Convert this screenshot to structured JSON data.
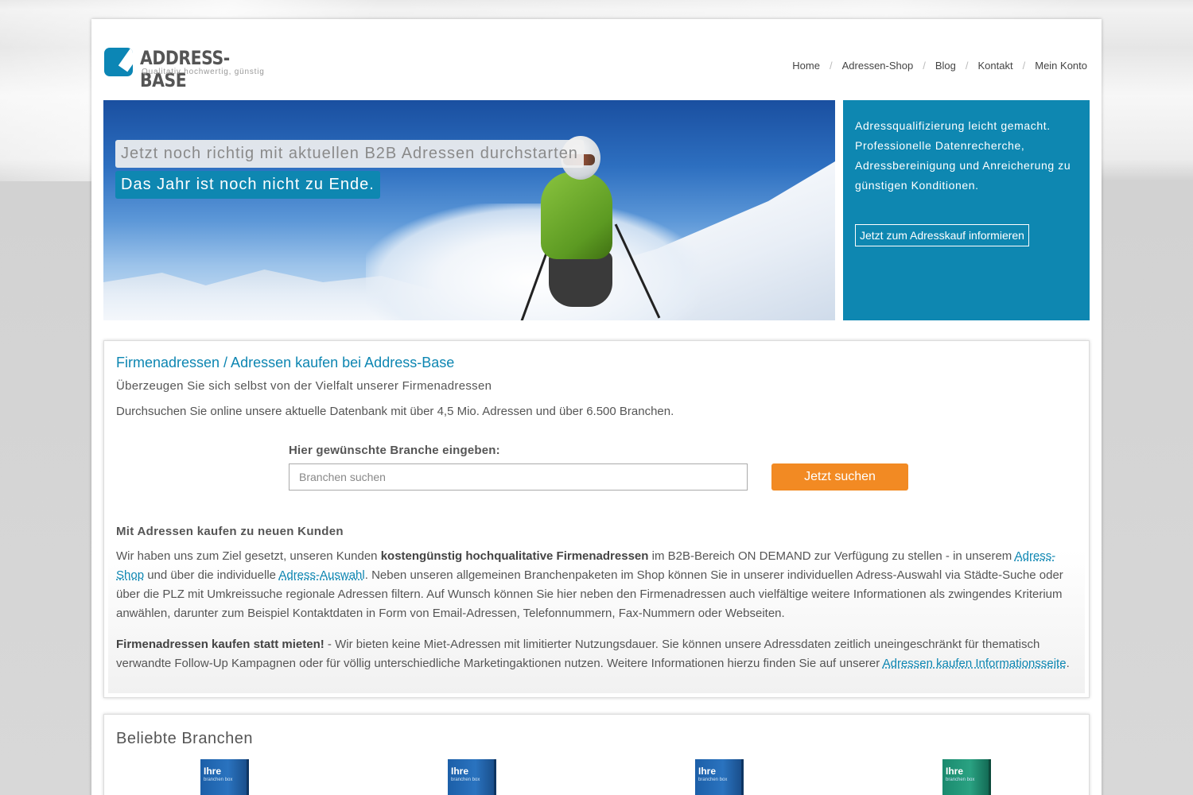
{
  "brand": {
    "name": "ADDRESS-BASE",
    "tagline": "Qualitativ hochwertig, günstig"
  },
  "nav": {
    "items": [
      {
        "label": "Home"
      },
      {
        "label": "Adressen-Shop"
      },
      {
        "label": "Blog"
      },
      {
        "label": "Kontakt"
      },
      {
        "label": "Mein Konto"
      }
    ],
    "separator": "/"
  },
  "hero": {
    "line1": "Jetzt noch richtig mit aktuellen B2B Adressen durchstarten",
    "line2": "Das Jahr ist noch nicht zu Ende."
  },
  "side_panel": {
    "text": "Adressqualifizierung leicht gemacht. Professionelle Datenrecherche, Adressbereinigung und Anreicherung zu günstigen Konditionen.",
    "button": "Jetzt zum Adresskauf informieren"
  },
  "main": {
    "title": "Firmenadressen / Adressen kaufen bei Address-Base",
    "subhead": "Überzeugen Sie sich selbst von der Vielfalt unserer Firmenadressen",
    "intro": "Durchsuchen Sie online unsere aktuelle Datenbank mit über 4,5 Mio. Adressen und über 6.500 Branchen.",
    "search": {
      "label": "Hier gewünschte Branche eingeben:",
      "placeholder": "Branchen suchen",
      "value": "",
      "button": "Jetzt suchen"
    },
    "section_title": "Mit Adressen kaufen zu neuen Kunden",
    "para1": {
      "t1": "Wir haben uns zum Ziel gesetzt, unseren Kunden ",
      "b1": "kostengünstig hochqualitative Firmenadressen",
      "t2": " im B2B-Bereich ON DEMAND zur Verfügung zu stellen - in unserem ",
      "link1": "Adress-Shop",
      "t3": " und über die individuelle ",
      "link2": "Adress-Auswahl",
      "t4": ". Neben unseren allgemeinen Branchenpaketen im Shop können Sie in unserer individuellen Adress-Auswahl via Städte-Suche oder über die PLZ mit Umkreissuche regionale Adressen filtern. Auf Wunsch können Sie hier neben den Firmenadressen auch vielfältige weitere Informationen als zwingendes Kriterium anwählen, darunter zum Beispiel Kontaktdaten in Form von Email-Adressen, Telefonnummern, Fax-Nummern oder Webseiten."
    },
    "para2": {
      "b1": "Firmenadressen kaufen statt mieten!",
      "t1": " - Wir bieten keine Miet-Adressen mit limitierter Nutzungsdauer. Sie können unsere Adressdaten zeitlich uneingeschränkt für thematisch verwandte Follow-Up Kampagnen oder für völlig unterschiedliche Marketingaktionen nutzen. Weitere Informationen hierzu finden Sie auf unserer ",
      "link1": "Adressen kaufen Informationsseite",
      "t2": "."
    }
  },
  "popular": {
    "title": "Beliebte Branchen",
    "products": [
      {
        "label": "Ihre",
        "sub": "branchen box",
        "color": "blue"
      },
      {
        "label": "Ihre",
        "sub": "branchen box",
        "color": "blue"
      },
      {
        "label": "Ihre",
        "sub": "branchen box",
        "color": "blue"
      },
      {
        "label": "Ihre",
        "sub": "branchen box",
        "color": "green"
      }
    ]
  }
}
